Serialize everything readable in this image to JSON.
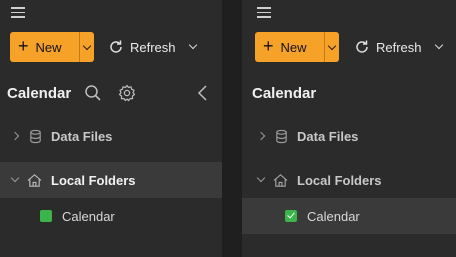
{
  "left": {
    "new_label": "New",
    "refresh_label": "Refresh",
    "title": "Calendar",
    "tree": {
      "data_files": "Data Files",
      "local_folders": "Local Folders",
      "calendar_item": "Calendar"
    }
  },
  "right": {
    "new_label": "New",
    "refresh_label": "Refresh",
    "title": "Calendar",
    "tree": {
      "data_files": "Data Files",
      "local_folders": "Local Folders",
      "calendar_item": "Calendar"
    }
  },
  "colors": {
    "accent": "#f6a128",
    "calendar_green": "#3bb54a",
    "panel_bg": "#2b2b2b",
    "selected_bg": "#3a3a3a"
  },
  "icons": [
    "hamburger-icon",
    "plus-icon",
    "chevron-down-icon",
    "refresh-icon",
    "search-icon",
    "gear-icon",
    "collapse-left-icon",
    "database-icon",
    "home-icon",
    "checkbox-icon"
  ]
}
